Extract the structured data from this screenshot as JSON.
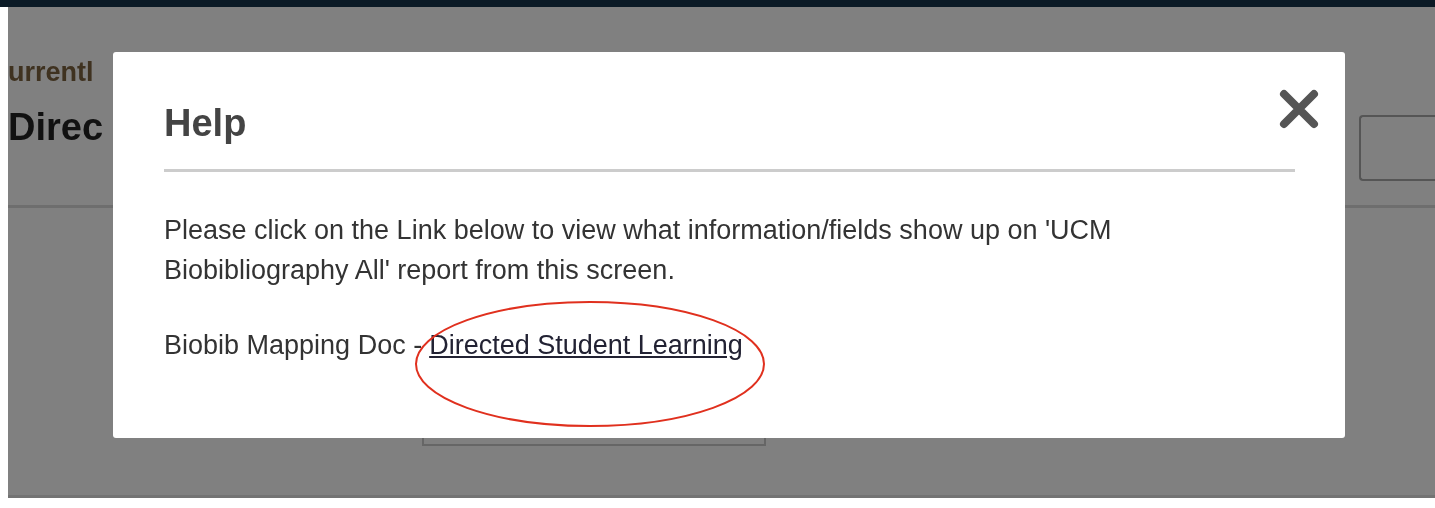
{
  "page": {
    "breadcrumb": "urrentl",
    "heading": "Direc"
  },
  "dialog": {
    "title": "Help",
    "message": "Please click on the Link below to view what information/fields show up on 'UCM Biobibliography All' report from this screen.",
    "doc_label": "Biobib Mapping Doc -",
    "link": "Directed Student Learning"
  }
}
